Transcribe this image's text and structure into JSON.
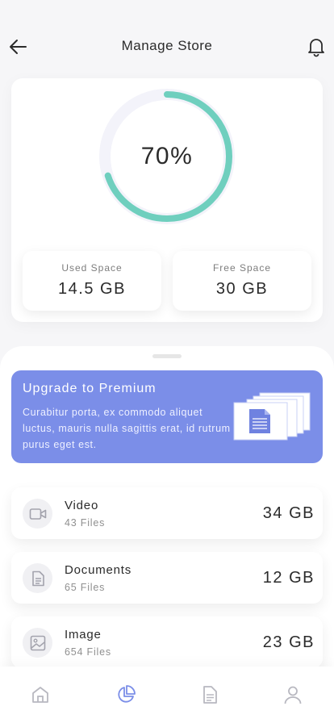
{
  "header": {
    "title": "Manage Store",
    "back_icon": "arrow-left-icon",
    "notify_icon": "bell-icon"
  },
  "storage": {
    "used_percent": 70,
    "percent_label": "70%",
    "ring_color": "#6fcfbe",
    "ring_track_color": "#f3f3fa",
    "used": {
      "label": "Used Space",
      "value": "14.5 GB"
    },
    "free": {
      "label": "Free Space",
      "value": "30 GB"
    }
  },
  "premium": {
    "title": "Upgrade to Premium",
    "description": "Curabitur porta, ex commodo aliquet luctus, mauris nulla sagittis erat, id rutrum purus eget est.",
    "background": "#7b8ee8",
    "icon": "document-stack-icon"
  },
  "files": [
    {
      "name": "Video",
      "count": "43 Files",
      "size": "34 GB",
      "icon": "video-icon"
    },
    {
      "name": "Documents",
      "count": "65 Files",
      "size": "12 GB",
      "icon": "document-icon"
    },
    {
      "name": "Image",
      "count": "654 Files",
      "size": "23 GB",
      "icon": "image-icon"
    }
  ],
  "nav": {
    "items": [
      {
        "icon": "home-icon",
        "active": false
      },
      {
        "icon": "pie-chart-icon",
        "active": true
      },
      {
        "icon": "file-icon",
        "active": false
      },
      {
        "icon": "user-icon",
        "active": false
      }
    ],
    "active_color": "#7b8ee8",
    "inactive_color": "#b8b8c0"
  }
}
